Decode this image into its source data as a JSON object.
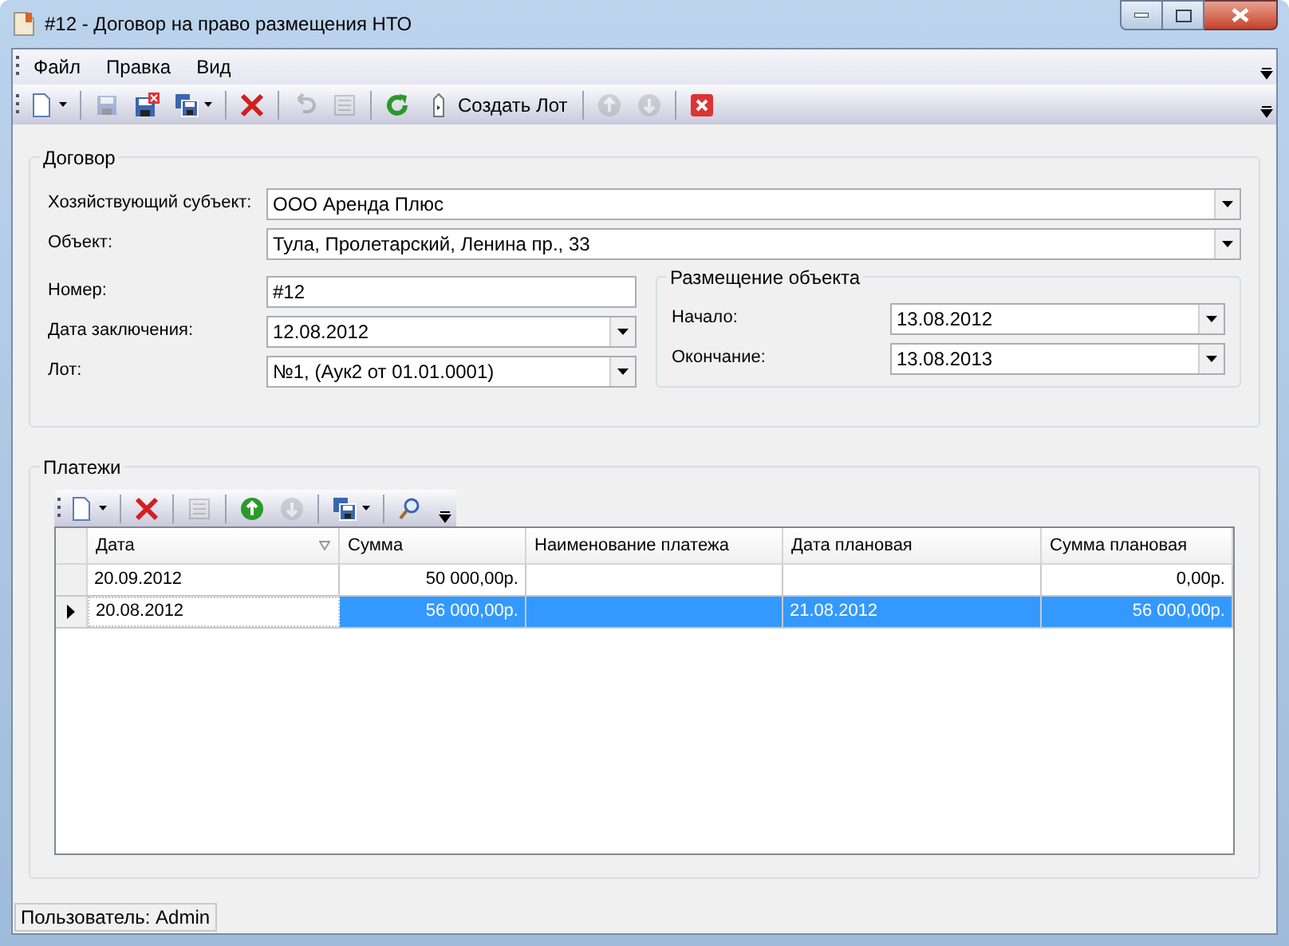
{
  "window": {
    "title": "#12 - Договор на право размещения НТО"
  },
  "menu": [
    "Файл",
    "Правка",
    "Вид"
  ],
  "toolbar": [
    {
      "kind": "button",
      "disabled": false,
      "menu": true
    },
    {
      "kind": "separator"
    },
    {
      "kind": "button",
      "disabled": true,
      "menu": false
    },
    {
      "kind": "button",
      "disabled": false,
      "menu": false
    },
    {
      "kind": "button",
      "disabled": false,
      "menu": true
    },
    {
      "kind": "separator"
    },
    {
      "kind": "button",
      "disabled": false,
      "menu": false
    },
    {
      "kind": "separator"
    },
    {
      "kind": "button",
      "disabled": true,
      "menu": false
    },
    {
      "kind": "button",
      "disabled": true,
      "menu": false
    },
    {
      "kind": "separator"
    },
    {
      "kind": "button",
      "disabled": false,
      "menu": false
    },
    {
      "kind": "text",
      "label": "Создать Лот",
      "disabled": false
    },
    {
      "kind": "separator"
    },
    {
      "kind": "button",
      "disabled": true,
      "menu": false
    },
    {
      "kind": "button",
      "disabled": true,
      "menu": false
    },
    {
      "kind": "separator"
    },
    {
      "kind": "button",
      "disabled": false,
      "menu": false
    }
  ],
  "contract": {
    "title": "Договор",
    "fields": [
      {
        "label": "Хозяйствующий субъект:",
        "value": "ООО Аренда Плюс",
        "kind": "combo"
      },
      {
        "label": "Объект:",
        "value": "Тула, Пролетарский, Ленина пр., 33",
        "kind": "combo"
      }
    ],
    "left_fields": [
      {
        "label": "Номер:",
        "value": "#12",
        "kind": "text"
      },
      {
        "label": "Дата заключения:",
        "value": "12.08.2012",
        "kind": "combo"
      },
      {
        "label": "Лот:",
        "value": "№1, (Аук2 от 01.01.0001)",
        "kind": "combo"
      }
    ],
    "placement": {
      "title": "Размещение объекта",
      "fields": [
        {
          "label": "Начало:",
          "value": "13.08.2012",
          "kind": "combo"
        },
        {
          "label": "Окончание:",
          "value": "13.08.2013",
          "kind": "combo"
        }
      ]
    }
  },
  "payments": {
    "title": "Платежи",
    "toolbar": [
      {
        "kind": "button",
        "disabled": false,
        "menu": true
      },
      {
        "kind": "separator"
      },
      {
        "kind": "button",
        "disabled": false,
        "menu": false
      },
      {
        "kind": "separator"
      },
      {
        "kind": "button",
        "disabled": true,
        "menu": false
      },
      {
        "kind": "separator"
      },
      {
        "kind": "button",
        "disabled": false,
        "menu": false
      },
      {
        "kind": "button",
        "disabled": true,
        "menu": false
      },
      {
        "kind": "separator"
      },
      {
        "kind": "button",
        "disabled": false,
        "menu": true
      },
      {
        "kind": "separator"
      },
      {
        "kind": "button",
        "disabled": false,
        "menu": false
      }
    ],
    "columns": [
      {
        "label": "Дата",
        "kind": "text",
        "sorted": true
      },
      {
        "label": "Сумма",
        "kind": "money",
        "sorted": false
      },
      {
        "label": "Наименование платежа",
        "kind": "text",
        "sorted": false
      },
      {
        "label": "Дата плановая",
        "kind": "text",
        "sorted": false
      },
      {
        "label": "Сумма плановая",
        "kind": "money",
        "sorted": false
      }
    ],
    "rows": [
      {
        "selected": false,
        "cells": [
          "20.09.2012",
          "50 000,00р.",
          "",
          "",
          "0,00р."
        ]
      },
      {
        "selected": true,
        "cells": [
          "20.08.2012",
          "56 000,00р.",
          "",
          "21.08.2012",
          "56 000,00р."
        ]
      }
    ]
  },
  "status_bar": "Пользователь: Admin"
}
